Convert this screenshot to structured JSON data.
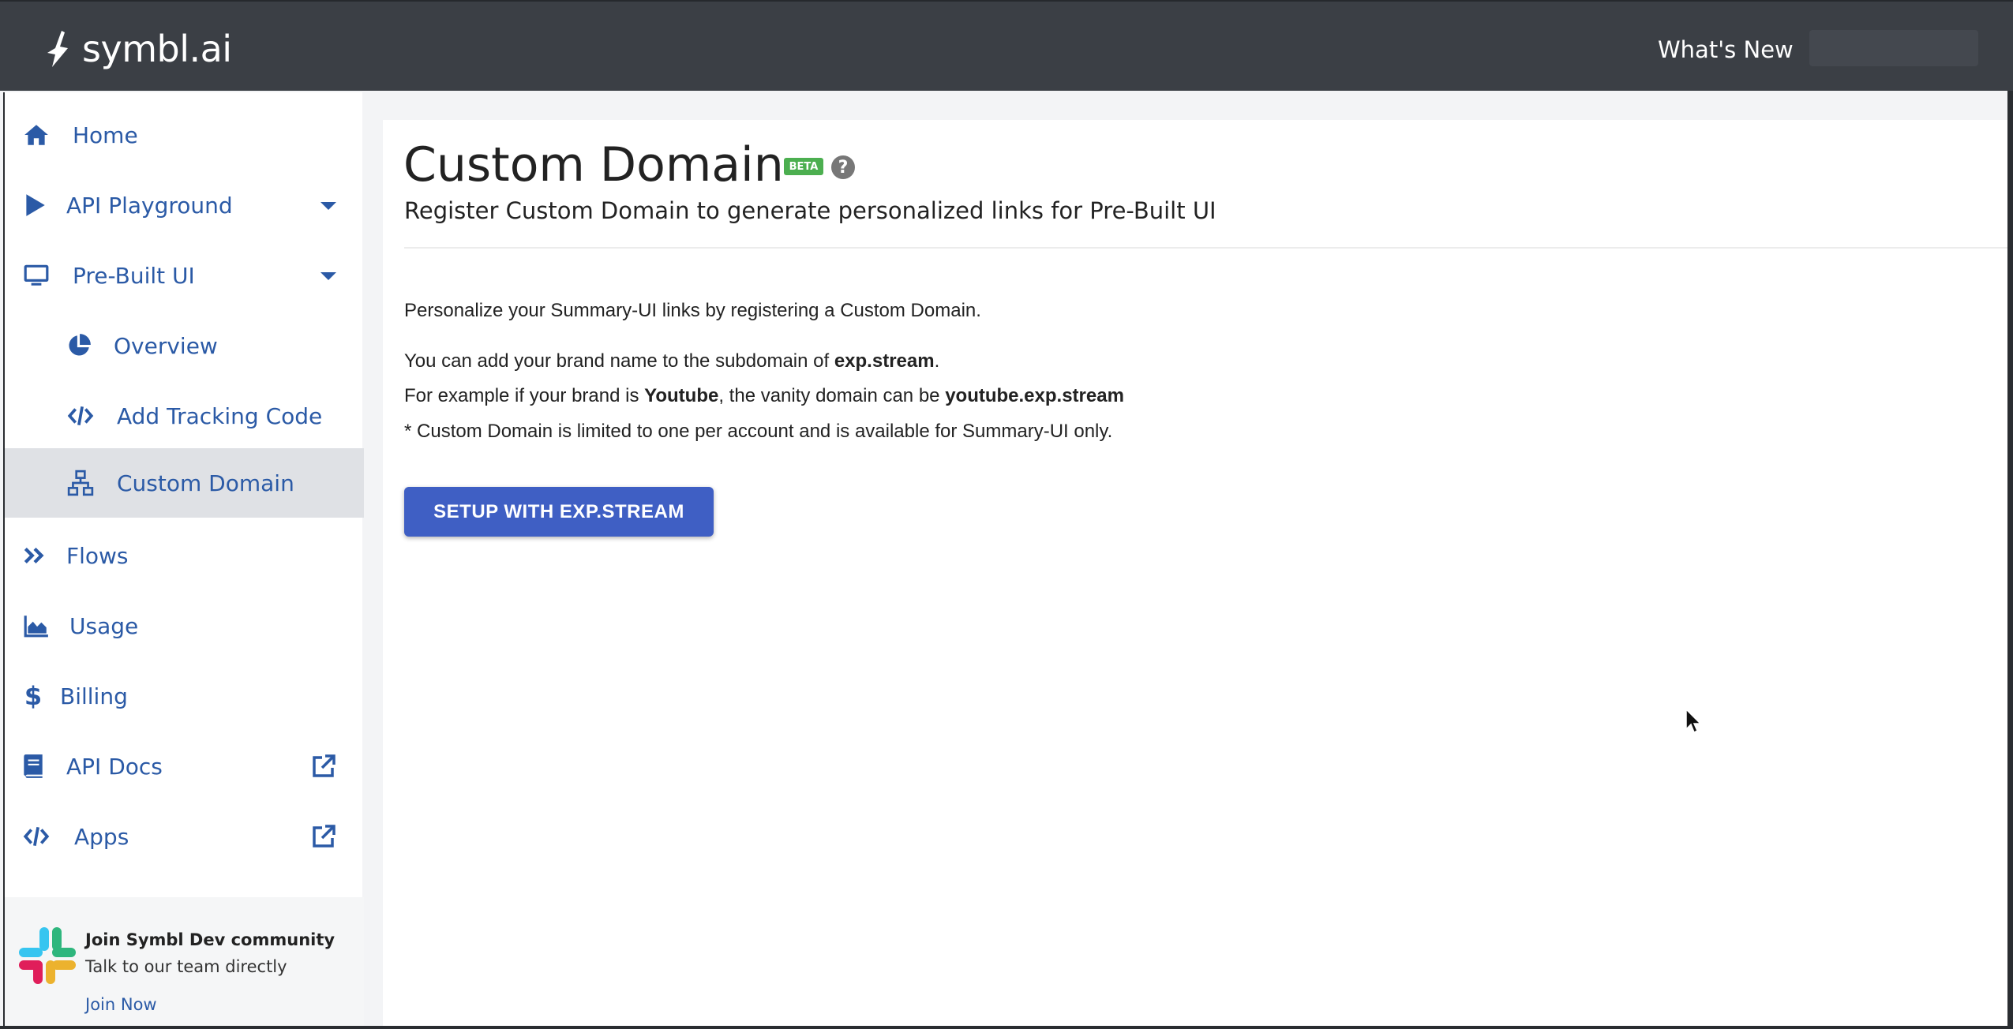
{
  "header": {
    "logo_text": "symbl.ai",
    "whats_new": "What's New"
  },
  "sidebar": {
    "items": [
      {
        "label": "Home",
        "icon": "home-icon"
      },
      {
        "label": "API Playground",
        "icon": "play-icon",
        "expandable": true
      },
      {
        "label": "Pre-Built UI",
        "icon": "monitor-icon",
        "expandable": true
      },
      {
        "label": "Overview",
        "icon": "pie-chart-icon",
        "sub": true
      },
      {
        "label": "Add Tracking Code",
        "icon": "code-icon",
        "sub": true
      },
      {
        "label": "Custom Domain",
        "icon": "sitemap-icon",
        "sub": true,
        "active": true
      },
      {
        "label": "Flows",
        "icon": "double-chevron-icon"
      },
      {
        "label": "Usage",
        "icon": "area-chart-icon"
      },
      {
        "label": "Billing",
        "icon": "dollar-icon"
      },
      {
        "label": "API Docs",
        "icon": "book-icon",
        "external": true
      },
      {
        "label": "Apps",
        "icon": "code-icon",
        "external": true
      }
    ],
    "community": {
      "title": "Join Symbl Dev community",
      "subtitle": "Talk to our team directly",
      "link": "Join Now"
    }
  },
  "main": {
    "title": "Custom Domain",
    "badge": "BETA",
    "help": "?",
    "subtitle": "Register Custom Domain to generate personalized links for Pre-Built UI",
    "intro": "Personalize your Summary-UI links by registering a Custom Domain.",
    "line1_prefix": "You can add your brand name to the subdomain of ",
    "line1_bold": "exp.stream",
    "line1_suffix": ".",
    "line2_prefix": "For example if your brand is ",
    "line2_bold1": "Youtube",
    "line2_mid": ", the vanity domain can be ",
    "line2_bold2": "youtube.exp.stream",
    "note": "* Custom Domain is limited to one per account and is available for Summary-UI only.",
    "button": "SETUP WITH EXP.STREAM"
  },
  "colors": {
    "accent": "#2b5aa6",
    "header_bg": "#3b3f45",
    "button_bg": "#3f5fc4",
    "badge_bg": "#4caf50",
    "active_bg": "#dfe1e5"
  }
}
